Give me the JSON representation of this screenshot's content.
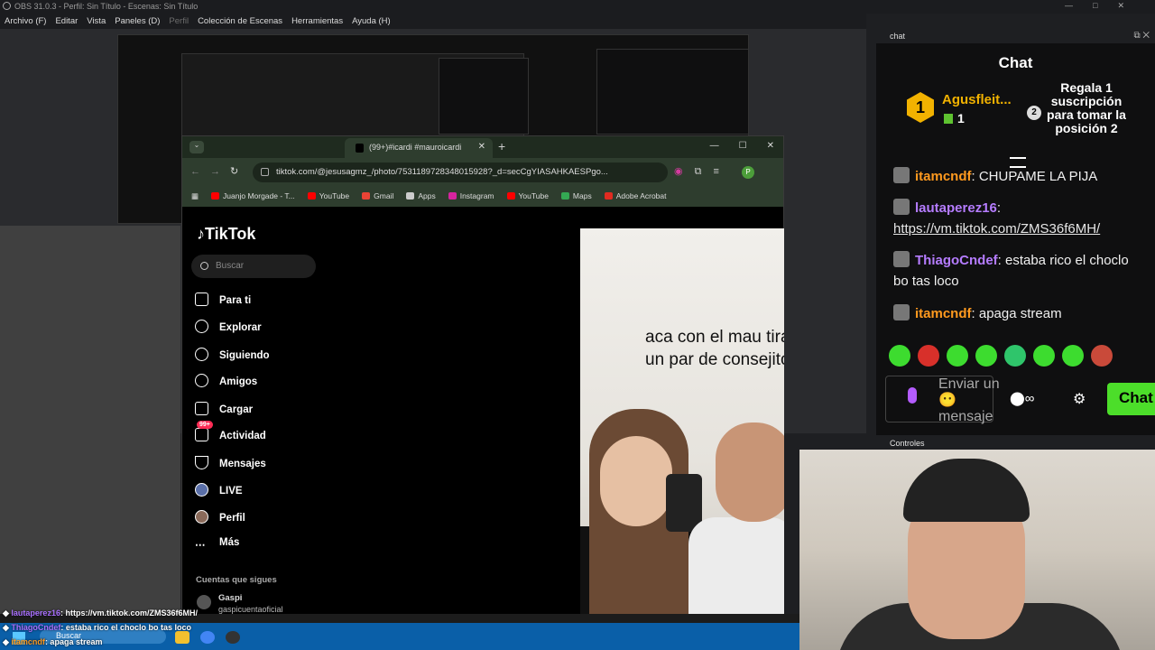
{
  "obs": {
    "title": "OBS 31.0.3 - Perfil: Sin Título - Escenas: Sin Título",
    "menu": [
      "Archivo (F)",
      "Editar",
      "Vista",
      "Paneles (D)",
      "Perfil",
      "Colección de Escenas",
      "Herramientas",
      "Ayuda (H)"
    ],
    "chat_dock_title": "chat",
    "controls_dock_title": "Controles"
  },
  "chat": {
    "title": "Chat",
    "gift": {
      "rank": "1",
      "user": "Agusfleit...",
      "count": "1",
      "position": "2",
      "text": "Regala 1 suscripción para tomar la posición 2"
    },
    "messages": [
      {
        "user": "itamcndf",
        "text": ": CHUPAME LA PIJA",
        "color": "#ff9a1f"
      },
      {
        "user": "lautaperez16",
        "text": ":",
        "link": "https://vm.tiktok.com/ZMS36f6MH/",
        "color": "#b57cff"
      },
      {
        "user": "ThiagoCndef",
        "text": ": estaba rico el choclo bo tas loco",
        "color": "#b57cff"
      },
      {
        "user": "itamcndf",
        "text": ": apaga stream",
        "color": "#ff9a1f"
      }
    ],
    "input_placeholder": "Enviar un 😶 mensaje",
    "send_label": "Chat"
  },
  "browser": {
    "tab_title": "(99+)#icardi #mauroicardi",
    "url": "tiktok.com/@jesusagmz_/photo/7531189728348015928?_d=secCgYIASAHKAESPgo...",
    "profile_initial": "P",
    "bookmarks": [
      {
        "label": "Juanjo Morgade - T...",
        "color": "#ff0000"
      },
      {
        "label": "YouTube",
        "color": "#ff0000"
      },
      {
        "label": "Gmail",
        "color": "#ea4335"
      },
      {
        "label": "Apps",
        "color": "#cccccc"
      },
      {
        "label": "Instagram",
        "color": "#d6249f"
      },
      {
        "label": "YouTube",
        "color": "#ff0000"
      },
      {
        "label": "Maps",
        "color": "#34a853"
      },
      {
        "label": "Adobe Acrobat",
        "color": "#e02b20"
      }
    ]
  },
  "tiktok": {
    "logo": "TikTok",
    "search_placeholder": "Buscar",
    "nav": [
      "Para ti",
      "Explorar",
      "Siguiendo",
      "Amigos",
      "Cargar",
      "Actividad",
      "Mensajes",
      "LIVE",
      "Perfil",
      "Más"
    ],
    "activity_badge": "99+",
    "following_title": "Cuentas que sigues",
    "following": {
      "name": "Gaspi",
      "handle": "gaspicuentaoficial"
    },
    "photo_caption": "aca con el mau tirando un par de consejitos"
  },
  "ticker": [
    {
      "user": "lautaperez16",
      "text": ": https://vm.tiktok.com/ZMS36f6MH/"
    },
    {
      "user": "ThiagoCndef",
      "text": ": estaba rico el choclo bo tas loco"
    },
    {
      "user": "itamcndf",
      "text": ": apaga stream"
    }
  ],
  "taskbar": {
    "search_label": "Buscar"
  }
}
